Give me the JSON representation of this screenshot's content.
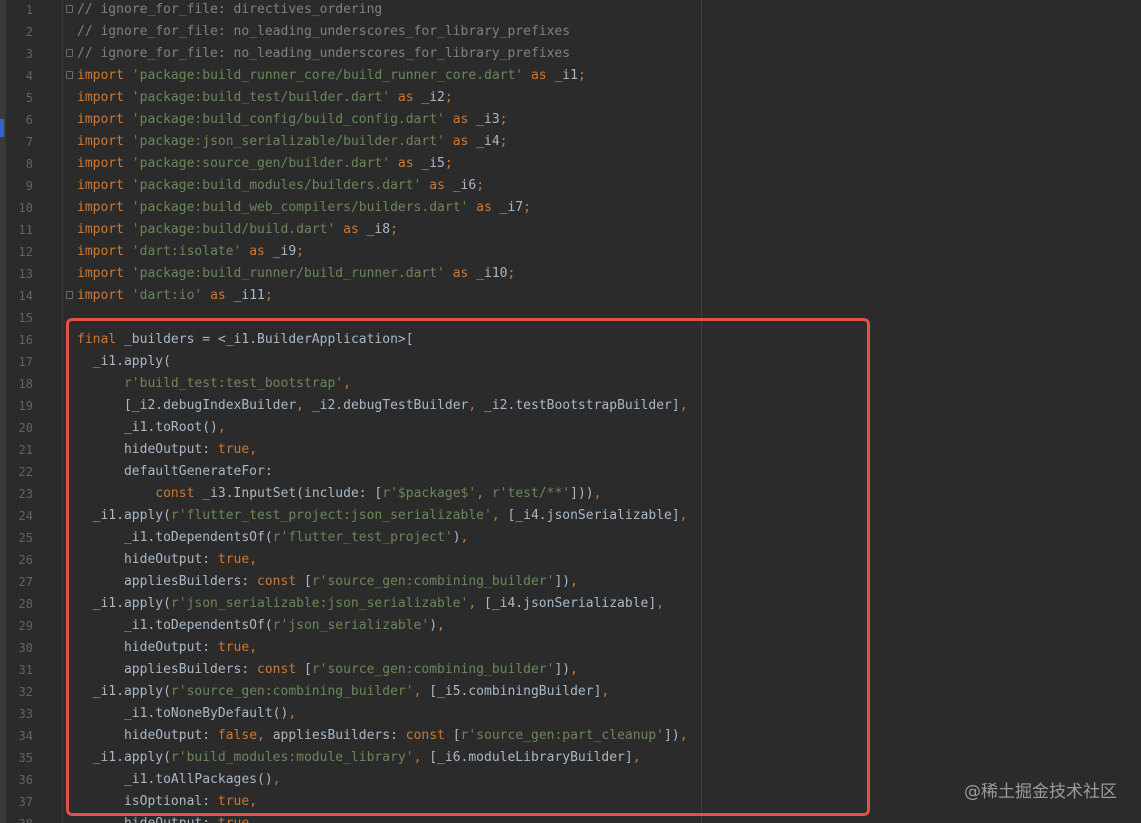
{
  "editor": {
    "first_line_number": 1,
    "lines": [
      {
        "tokens": [
          {
            "t": "// ignore_for_file: directives_ordering",
            "c": "c"
          }
        ],
        "fold": true
      },
      {
        "tokens": [
          {
            "t": "// ignore_for_file: no_leading_underscores_for_library_prefixes",
            "c": "c"
          }
        ]
      },
      {
        "tokens": [
          {
            "t": "// ignore_for_file: no_leading_underscores_for_library_prefixes",
            "c": "c"
          }
        ],
        "fold": true
      },
      {
        "tokens": [
          {
            "t": "import ",
            "c": "k"
          },
          {
            "t": "'package:build_runner_core/build_runner_core.dart'",
            "c": "s"
          },
          {
            "t": " as ",
            "c": "k"
          },
          {
            "t": "_i1",
            "c": "p"
          },
          {
            "t": ";",
            "c": "k"
          }
        ],
        "fold": true
      },
      {
        "tokens": [
          {
            "t": "import ",
            "c": "k"
          },
          {
            "t": "'package:build_test/builder.dart'",
            "c": "s"
          },
          {
            "t": " as ",
            "c": "k"
          },
          {
            "t": "_i2",
            "c": "p"
          },
          {
            "t": ";",
            "c": "k"
          }
        ]
      },
      {
        "tokens": [
          {
            "t": "import ",
            "c": "k"
          },
          {
            "t": "'package:build_config/build_config.dart'",
            "c": "s"
          },
          {
            "t": " as ",
            "c": "k"
          },
          {
            "t": "_i3",
            "c": "p"
          },
          {
            "t": ";",
            "c": "k"
          }
        ]
      },
      {
        "tokens": [
          {
            "t": "import ",
            "c": "k"
          },
          {
            "t": "'package:json_serializable/builder.dart'",
            "c": "s"
          },
          {
            "t": " as ",
            "c": "k"
          },
          {
            "t": "_i4",
            "c": "p"
          },
          {
            "t": ";",
            "c": "k"
          }
        ]
      },
      {
        "tokens": [
          {
            "t": "import ",
            "c": "k"
          },
          {
            "t": "'package:source_gen/builder.dart'",
            "c": "s"
          },
          {
            "t": " as ",
            "c": "k"
          },
          {
            "t": "_i5",
            "c": "p"
          },
          {
            "t": ";",
            "c": "k"
          }
        ]
      },
      {
        "tokens": [
          {
            "t": "import ",
            "c": "k"
          },
          {
            "t": "'package:build_modules/builders.dart'",
            "c": "s"
          },
          {
            "t": " as ",
            "c": "k"
          },
          {
            "t": "_i6",
            "c": "p"
          },
          {
            "t": ";",
            "c": "k"
          }
        ]
      },
      {
        "tokens": [
          {
            "t": "import ",
            "c": "k"
          },
          {
            "t": "'package:build_web_compilers/builders.dart'",
            "c": "s"
          },
          {
            "t": " as ",
            "c": "k"
          },
          {
            "t": "_i7",
            "c": "p"
          },
          {
            "t": ";",
            "c": "k"
          }
        ]
      },
      {
        "tokens": [
          {
            "t": "import ",
            "c": "k"
          },
          {
            "t": "'package:build/build.dart'",
            "c": "s"
          },
          {
            "t": " as ",
            "c": "k"
          },
          {
            "t": "_i8",
            "c": "p"
          },
          {
            "t": ";",
            "c": "k"
          }
        ]
      },
      {
        "tokens": [
          {
            "t": "import ",
            "c": "k"
          },
          {
            "t": "'dart:isolate'",
            "c": "s"
          },
          {
            "t": " as ",
            "c": "k"
          },
          {
            "t": "_i9",
            "c": "p"
          },
          {
            "t": ";",
            "c": "k"
          }
        ]
      },
      {
        "tokens": [
          {
            "t": "import ",
            "c": "k"
          },
          {
            "t": "'package:build_runner/build_runner.dart'",
            "c": "s"
          },
          {
            "t": " as ",
            "c": "k"
          },
          {
            "t": "_i10",
            "c": "p"
          },
          {
            "t": ";",
            "c": "k"
          }
        ]
      },
      {
        "tokens": [
          {
            "t": "import ",
            "c": "k"
          },
          {
            "t": "'dart:io'",
            "c": "s"
          },
          {
            "t": " as ",
            "c": "k"
          },
          {
            "t": "_i11",
            "c": "p"
          },
          {
            "t": ";",
            "c": "k"
          }
        ],
        "fold": true
      },
      {
        "tokens": []
      },
      {
        "tokens": [
          {
            "t": "final ",
            "c": "k"
          },
          {
            "t": "_builders = <_i1.BuilderApplication>[",
            "c": "p"
          }
        ]
      },
      {
        "tokens": [
          {
            "t": "  _i1.apply(",
            "c": "p"
          }
        ]
      },
      {
        "tokens": [
          {
            "t": "      ",
            "c": "p"
          },
          {
            "t": "r'build_test:test_bootstrap'",
            "c": "s"
          },
          {
            "t": ",",
            "c": "k"
          }
        ]
      },
      {
        "tokens": [
          {
            "t": "      [_i2.debugIndexBuilder",
            "c": "p"
          },
          {
            "t": ", ",
            "c": "k"
          },
          {
            "t": "_i2.debugTestBuilder",
            "c": "p"
          },
          {
            "t": ", ",
            "c": "k"
          },
          {
            "t": "_i2.testBootstrapBuilder]",
            "c": "p"
          },
          {
            "t": ",",
            "c": "k"
          }
        ]
      },
      {
        "tokens": [
          {
            "t": "      _i1.toRoot()",
            "c": "p"
          },
          {
            "t": ",",
            "c": "k"
          }
        ]
      },
      {
        "tokens": [
          {
            "t": "      hideOutput: ",
            "c": "p"
          },
          {
            "t": "true",
            "c": "k"
          },
          {
            "t": ",",
            "c": "k"
          }
        ]
      },
      {
        "tokens": [
          {
            "t": "      defaultGenerateFor:",
            "c": "p"
          }
        ]
      },
      {
        "tokens": [
          {
            "t": "          ",
            "c": "p"
          },
          {
            "t": "const ",
            "c": "k"
          },
          {
            "t": "_i3.InputSet(include: [",
            "c": "p"
          },
          {
            "t": "r'$package$'",
            "c": "s"
          },
          {
            "t": ", ",
            "c": "k"
          },
          {
            "t": "r'test/**'",
            "c": "s"
          },
          {
            "t": "]))",
            "c": "p"
          },
          {
            "t": ",",
            "c": "k"
          }
        ]
      },
      {
        "tokens": [
          {
            "t": "  _i1.apply(",
            "c": "p"
          },
          {
            "t": "r'flutter_test_project:json_serializable'",
            "c": "s"
          },
          {
            "t": ", ",
            "c": "k"
          },
          {
            "t": "[_i4.jsonSerializable]",
            "c": "p"
          },
          {
            "t": ",",
            "c": "k"
          }
        ]
      },
      {
        "tokens": [
          {
            "t": "      _i1.toDependentsOf(",
            "c": "p"
          },
          {
            "t": "r'flutter_test_project'",
            "c": "s"
          },
          {
            "t": ")",
            "c": "p"
          },
          {
            "t": ",",
            "c": "k"
          }
        ]
      },
      {
        "tokens": [
          {
            "t": "      hideOutput: ",
            "c": "p"
          },
          {
            "t": "true",
            "c": "k"
          },
          {
            "t": ",",
            "c": "k"
          }
        ]
      },
      {
        "tokens": [
          {
            "t": "      appliesBuilders: ",
            "c": "p"
          },
          {
            "t": "const ",
            "c": "k"
          },
          {
            "t": "[",
            "c": "p"
          },
          {
            "t": "r'source_gen:combining_builder'",
            "c": "s"
          },
          {
            "t": "])",
            "c": "p"
          },
          {
            "t": ",",
            "c": "k"
          }
        ]
      },
      {
        "tokens": [
          {
            "t": "  _i1.apply(",
            "c": "p"
          },
          {
            "t": "r'json_serializable:json_serializable'",
            "c": "s"
          },
          {
            "t": ", ",
            "c": "k"
          },
          {
            "t": "[_i4.jsonSerializable]",
            "c": "p"
          },
          {
            "t": ",",
            "c": "k"
          }
        ]
      },
      {
        "tokens": [
          {
            "t": "      _i1.toDependentsOf(",
            "c": "p"
          },
          {
            "t": "r'json_serializable'",
            "c": "s"
          },
          {
            "t": ")",
            "c": "p"
          },
          {
            "t": ",",
            "c": "k"
          }
        ]
      },
      {
        "tokens": [
          {
            "t": "      hideOutput: ",
            "c": "p"
          },
          {
            "t": "true",
            "c": "k"
          },
          {
            "t": ",",
            "c": "k"
          }
        ]
      },
      {
        "tokens": [
          {
            "t": "      appliesBuilders: ",
            "c": "p"
          },
          {
            "t": "const ",
            "c": "k"
          },
          {
            "t": "[",
            "c": "p"
          },
          {
            "t": "r'source_gen:combining_builder'",
            "c": "s"
          },
          {
            "t": "])",
            "c": "p"
          },
          {
            "t": ",",
            "c": "k"
          }
        ]
      },
      {
        "tokens": [
          {
            "t": "  _i1.apply(",
            "c": "p"
          },
          {
            "t": "r'source_gen:combining_builder'",
            "c": "s"
          },
          {
            "t": ", ",
            "c": "k"
          },
          {
            "t": "[_i5.combiningBuilder]",
            "c": "p"
          },
          {
            "t": ",",
            "c": "k"
          }
        ]
      },
      {
        "tokens": [
          {
            "t": "      _i1.toNoneByDefault()",
            "c": "p"
          },
          {
            "t": ",",
            "c": "k"
          }
        ]
      },
      {
        "tokens": [
          {
            "t": "      hideOutput: ",
            "c": "p"
          },
          {
            "t": "false",
            "c": "k"
          },
          {
            "t": ", ",
            "c": "k"
          },
          {
            "t": "appliesBuilders: ",
            "c": "p"
          },
          {
            "t": "const ",
            "c": "k"
          },
          {
            "t": "[",
            "c": "p"
          },
          {
            "t": "r'source_gen:part_cleanup'",
            "c": "s"
          },
          {
            "t": "])",
            "c": "p"
          },
          {
            "t": ",",
            "c": "k"
          }
        ]
      },
      {
        "tokens": [
          {
            "t": "  _i1.apply(",
            "c": "p"
          },
          {
            "t": "r'build_modules:module_library'",
            "c": "s"
          },
          {
            "t": ", ",
            "c": "k"
          },
          {
            "t": "[_i6.moduleLibraryBuilder]",
            "c": "p"
          },
          {
            "t": ",",
            "c": "k"
          }
        ]
      },
      {
        "tokens": [
          {
            "t": "      _i1.toAllPackages()",
            "c": "p"
          },
          {
            "t": ",",
            "c": "k"
          }
        ]
      },
      {
        "tokens": [
          {
            "t": "      isOptional: ",
            "c": "p"
          },
          {
            "t": "true",
            "c": "k"
          },
          {
            "t": ",",
            "c": "k"
          }
        ]
      },
      {
        "tokens": [
          {
            "t": "      hideOutput: ",
            "c": "p"
          },
          {
            "t": "true",
            "c": "k"
          },
          {
            "t": ",",
            "c": "k"
          }
        ]
      }
    ]
  },
  "colors": {
    "background": "#2b2b2b",
    "comment": "#808080",
    "keyword": "#cc7832",
    "string": "#6a8759",
    "plain": "#a9b7c6",
    "line_number": "#606366",
    "highlight_border": "#e0524a"
  },
  "watermark": {
    "text": "@稀土掘金技术社区"
  }
}
